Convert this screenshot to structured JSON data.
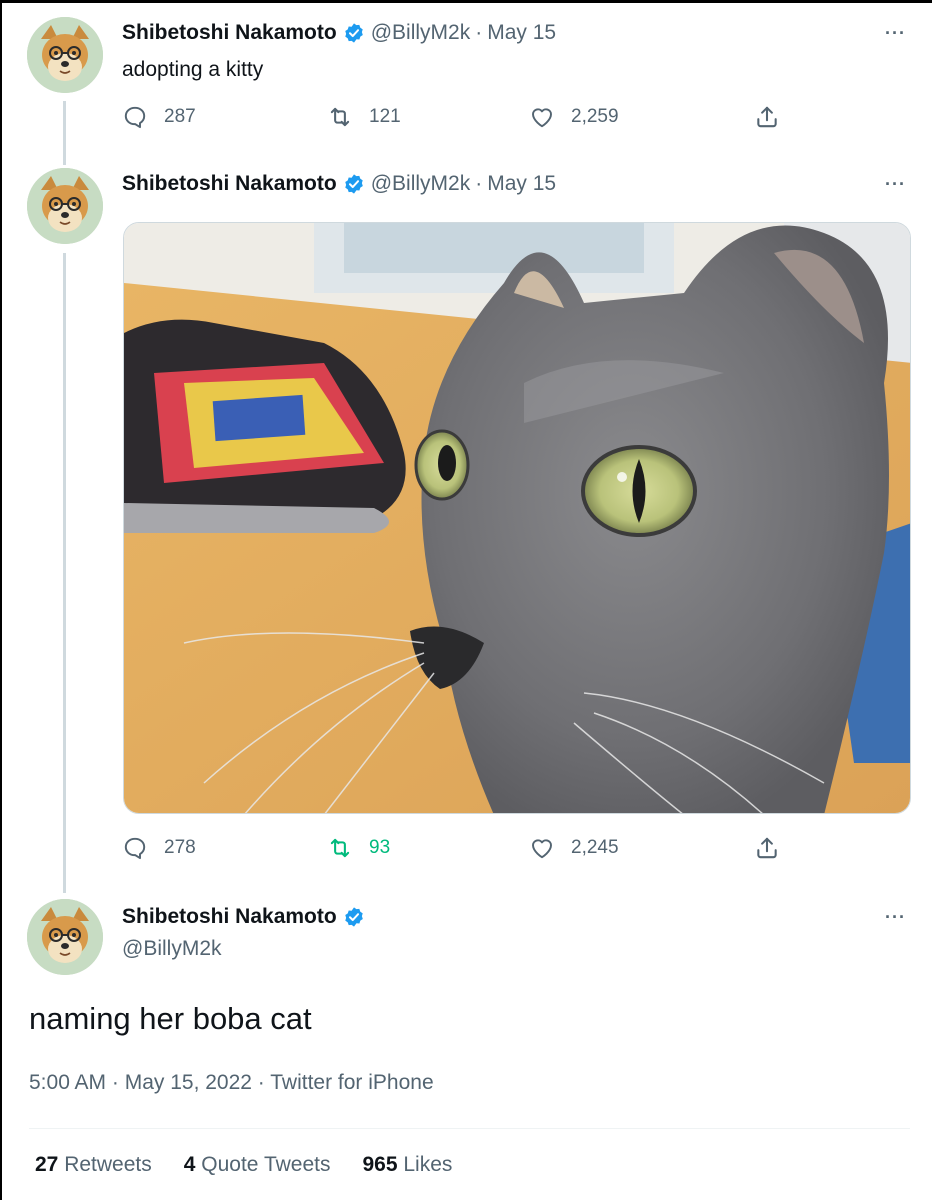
{
  "tweets": [
    {
      "name": "Shibetoshi Nakamoto",
      "handle": "@BillyM2k",
      "separator": "·",
      "date": "May 15",
      "text": "adopting a kitty",
      "more": "···",
      "replies": "287",
      "retweets": "121",
      "likes": "2,259"
    },
    {
      "name": "Shibetoshi Nakamoto",
      "handle": "@BillyM2k",
      "separator": "·",
      "date": "May 15",
      "more": "···",
      "replies": "278",
      "retweets": "93",
      "likes": "2,245"
    }
  ],
  "focal": {
    "name": "Shibetoshi Nakamoto",
    "handle": "@BillyM2k",
    "more": "···",
    "text": "naming her boba cat",
    "meta": "5:00 AM · May 15, 2022 · Twitter for iPhone",
    "retweets_count": "27",
    "retweets_label": "Retweets",
    "quotes_count": "4",
    "quotes_label": "Quote Tweets",
    "likes_count": "965",
    "likes_label": "Likes"
  },
  "colors": {
    "verified": "#1d9bf0",
    "retweet_active": "#00ba7c",
    "secondary_text": "#536471"
  },
  "icons": [
    "reply-icon",
    "retweet-icon",
    "like-icon",
    "share-icon",
    "verified-badge-icon",
    "more-icon"
  ]
}
